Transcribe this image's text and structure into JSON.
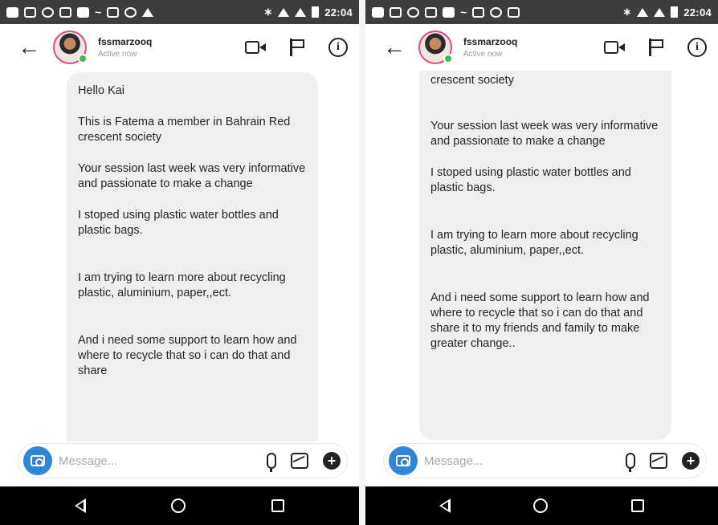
{
  "status_bar": {
    "time": "22:04"
  },
  "header": {
    "username": "fssmarzooq",
    "status": "Active now"
  },
  "composer": {
    "placeholder": "Message..."
  },
  "left_panel": {
    "messages": [
      "Hello Kai",
      "This is Fatema  a member in Bahrain Red crescent society",
      "Your session last week was very informative and passionate to make a change",
      "I stoped using plastic water bottles and plastic bags.",
      "I am trying to learn more about recycling plastic, aluminium, paper,,ect.",
      "And i need some support to learn how and where to recycle that so i can do that and share"
    ]
  },
  "right_panel": {
    "messages": [
      "This is Fatema  a member in Bahrain Red crescent society",
      "Your session last week was very informative and passionate to make a change",
      "I stoped using plastic water bottles and plastic bags.",
      "I am trying to learn more about recycling plastic, aluminium, paper,,ect.",
      "And i need some support to learn how and where to recycle that so i can do that and share it to my friends and family to make greater change.."
    ]
  },
  "colors": {
    "accent": "#2f86d8",
    "bubble": "#efefef",
    "online": "#3cba54",
    "status_bar": "#3d3d3d"
  }
}
